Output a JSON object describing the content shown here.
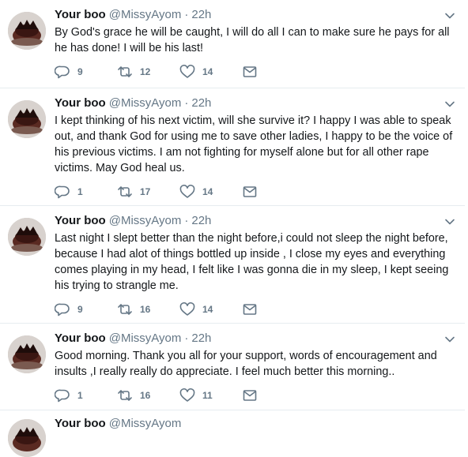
{
  "tweets": [
    {
      "name": "Your boo",
      "handle": "@MissyAyom",
      "separator": "·",
      "time": "22h",
      "text": "By God's grace he will be caught, I will do all I can to make sure he pays for all he has done! I will be his last!",
      "replies": "9",
      "retweets": "12",
      "likes": "14"
    },
    {
      "name": "Your boo",
      "handle": "@MissyAyom",
      "separator": "·",
      "time": "22h",
      "text": "I kept thinking of his next victim, will she survive it? I happy I was able to speak out, and thank God for using me to save other ladies, I happy to be the voice of his previous victims. I am not fighting for myself alone but for all other rape victims. May God heal us.",
      "replies": "1",
      "retweets": "17",
      "likes": "14"
    },
    {
      "name": "Your boo",
      "handle": "@MissyAyom",
      "separator": "·",
      "time": "22h",
      "text": "Last night I slept better than the night before,i could not sleep the night before, because I had alot of things bottled up inside , I close my eyes and everything comes playing in my head, I felt like I was gonna die in my sleep, I kept seeing his trying to strangle me.",
      "replies": "9",
      "retweets": "16",
      "likes": "14"
    },
    {
      "name": "Your boo",
      "handle": "@MissyAyom",
      "separator": "·",
      "time": "22h",
      "text": "Good morning.  Thank you all for your support, words of encouragement and insults ,I really really do appreciate. I feel much better this morning..",
      "replies": "1",
      "retweets": "16",
      "likes": "11"
    }
  ],
  "partial_tweet": {
    "name": "Your boo",
    "handle": "@MissyAyom"
  },
  "icons": {
    "reply": "reply-icon",
    "retweet": "retweet-icon",
    "like": "heart-icon",
    "dm": "envelope-icon",
    "caret": "chevron-down-icon"
  },
  "colors": {
    "text": "#14171a",
    "secondary": "#657786",
    "border": "#e6ecf0"
  }
}
